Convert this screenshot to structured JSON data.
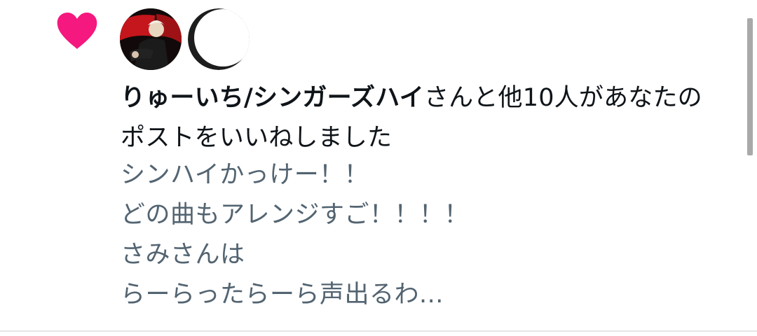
{
  "notification": {
    "likers_name": "りゅーいち/シンガーズハイ",
    "liked_text": "さんと他10人があなたのポストをいいねしました",
    "post_lines": [
      "シンハイかっけー！！",
      "どの曲もアレンジすご！！！！",
      "さみさんは",
      "らーらったらーら声出るわ..."
    ]
  },
  "icons": {
    "like": "heart-icon"
  },
  "colors": {
    "heart": "#f5187e",
    "headline_text": "#0f1419",
    "post_text": "#536471",
    "divider": "#e6e6e6"
  }
}
